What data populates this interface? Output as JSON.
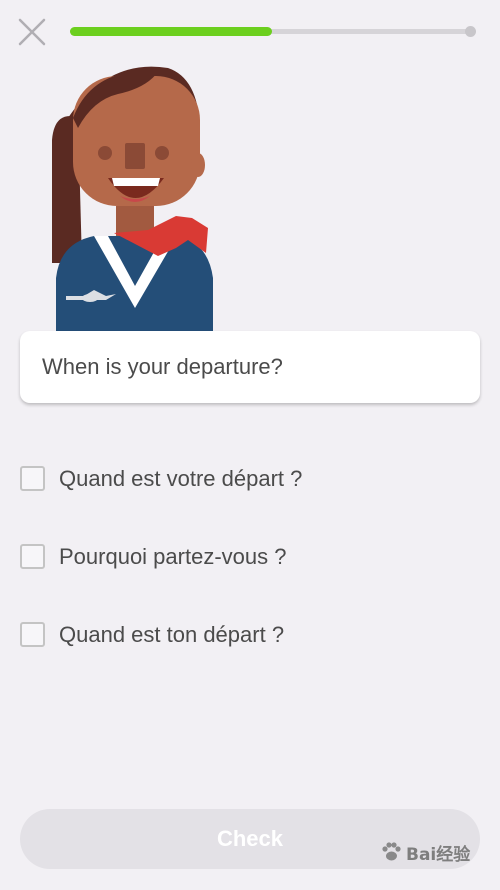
{
  "header": {
    "close_icon": "close-icon",
    "progress": 0.5
  },
  "character": {
    "icon": "flight-attendant-illustration"
  },
  "prompt": {
    "text": "When is your departure?"
  },
  "options": [
    {
      "label": "Quand est votre départ ?",
      "checked": false
    },
    {
      "label": "Pourquoi partez-vous ?",
      "checked": false
    },
    {
      "label": "Quand est ton départ ?",
      "checked": false
    }
  ],
  "footer": {
    "check_label": "Check",
    "check_enabled": false
  },
  "watermark": {
    "text": "Bai经验"
  },
  "colors": {
    "progress": "#6ccf1e",
    "background": "#f2f0f4",
    "button_disabled": "#e3e1e6"
  }
}
